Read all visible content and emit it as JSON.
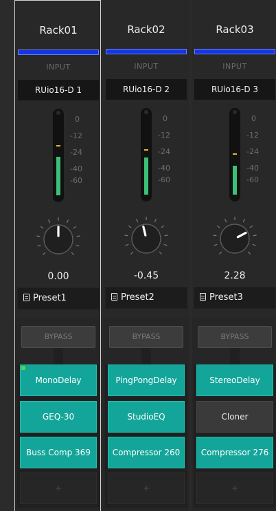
{
  "colors": {
    "background": "#2b2b2b",
    "input_bar": "#1436e0",
    "meter_level": "#3dbf77",
    "meter_peak": "#e5b836",
    "plugin_on": "#14a59a",
    "plugin_off": "#3a3a3a",
    "plugin_status": "#53d24f"
  },
  "meter_scale": [
    "0",
    "-12",
    "-24",
    "-40",
    "-60"
  ],
  "racks": [
    {
      "name": "Rack01",
      "selected": true,
      "input_label": "INPUT",
      "input_source": "RUio16-D 1",
      "meter": {
        "level_db": -20,
        "peak_db": -9
      },
      "knob": {
        "value": "0.00",
        "position": 0.5
      },
      "preset": "Preset1",
      "bypass_label": "BYPASS",
      "plugins": [
        {
          "name": "MonoDelay",
          "active": true,
          "status_indicator": true
        },
        {
          "name": "GEQ-30",
          "active": true
        },
        {
          "name": "Buss Comp 369",
          "active": true
        }
      ],
      "add_slot_label": "+"
    },
    {
      "name": "Rack02",
      "selected": false,
      "input_label": "INPUT",
      "input_source": "RUio16-D 2",
      "meter": {
        "level_db": -21,
        "peak_db": -14
      },
      "knob": {
        "value": "-0.45",
        "position": 0.45
      },
      "preset": "Preset2",
      "bypass_label": "BYPASS",
      "plugins": [
        {
          "name": "PingPongDelay",
          "active": true
        },
        {
          "name": "StudioEQ",
          "active": true
        },
        {
          "name": "Compressor 260",
          "active": true
        }
      ],
      "add_slot_label": "+"
    },
    {
      "name": "Rack03",
      "selected": false,
      "input_label": "INPUT",
      "input_source": "RUio16-D 3",
      "meter": {
        "level_db": -30,
        "peak_db": -18
      },
      "knob": {
        "value": "2.28",
        "position": 0.73
      },
      "preset": "Preset3",
      "bypass_label": "BYPASS",
      "plugins": [
        {
          "name": "StereoDelay",
          "active": true
        },
        {
          "name": "Cloner",
          "active": false
        },
        {
          "name": "Compressor 276",
          "active": true
        }
      ],
      "add_slot_label": "+"
    }
  ]
}
